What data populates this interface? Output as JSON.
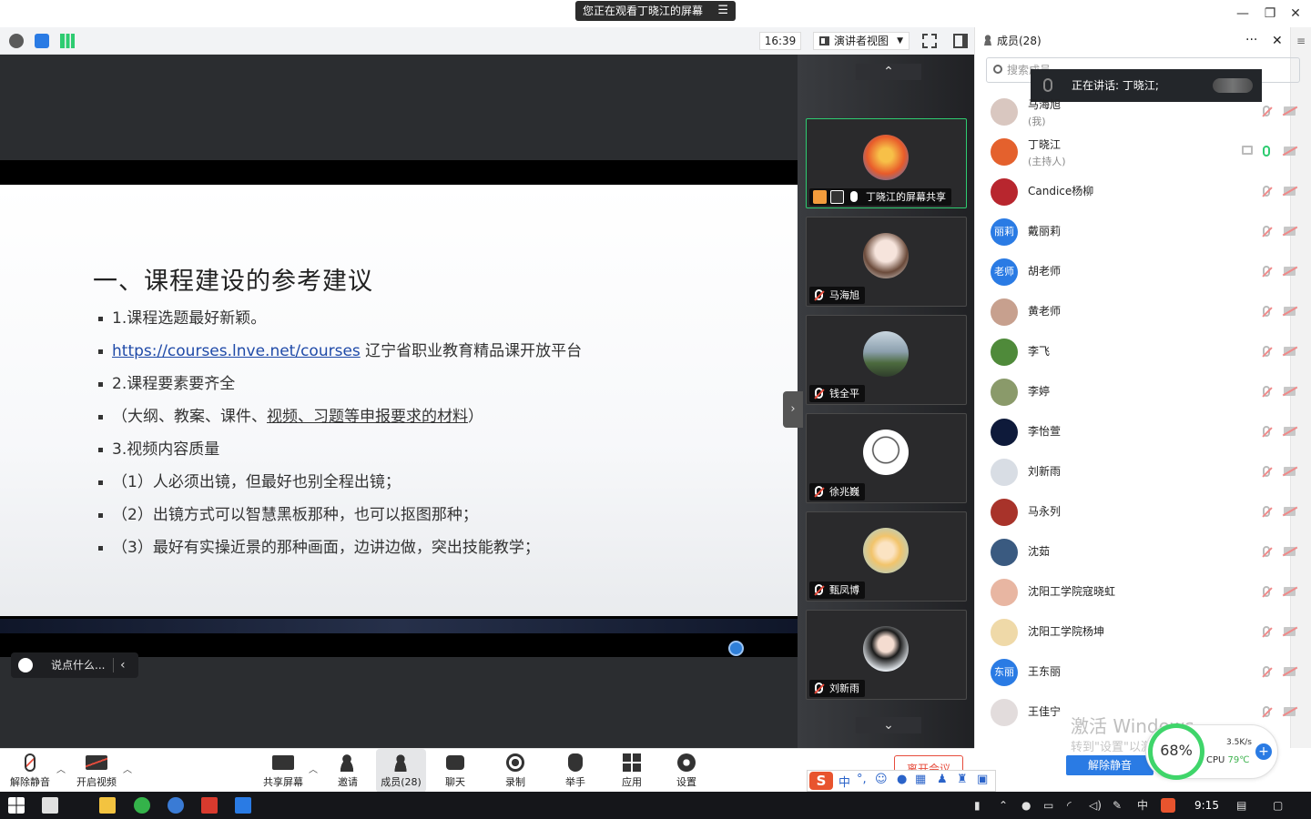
{
  "window": {
    "title": "您正在观看丁晓江的屏幕",
    "minimize": "—",
    "maximize": "❐",
    "close": "✕"
  },
  "toolbar": {
    "time": "16:39",
    "view_mode": "演讲者视图"
  },
  "slide": {
    "title": "一、课程建设的参考建议",
    "bullets": [
      {
        "pre": "1.课程选题最好新颖。",
        "link": "",
        "post": ""
      },
      {
        "pre": "",
        "link": "https://courses.lnve.net/courses",
        "post": " 辽宁省职业教育精品课开放平台"
      },
      {
        "pre": "2.课程要素要齐全",
        "link": "",
        "post": ""
      },
      {
        "pre": "（大纲、教案、课件、",
        "underline": "视频、习题等申报要求的材料",
        "post": "）"
      },
      {
        "pre": "3.视频内容质量",
        "link": "",
        "post": ""
      },
      {
        "pre": "（1）人必须出镜，但最好也别全程出镜；",
        "link": "",
        "post": ""
      },
      {
        "pre": "（2）出镜方式可以智慧黑板那种，也可以抠图那种；",
        "link": "",
        "post": ""
      },
      {
        "pre": "（3）最好有实操近景的那种画面，边讲边做，突出技能教学；",
        "link": "",
        "post": ""
      }
    ]
  },
  "chat": {
    "placeholder": "说点什么..."
  },
  "gallery": {
    "tiles": [
      {
        "name": "丁晓江的屏幕共享",
        "color": "#e85b2a"
      },
      {
        "name": "马海旭",
        "color": "#d8c7c2"
      },
      {
        "name": "钱全平",
        "color": "#7f9bb0"
      },
      {
        "name": "徐兆巍",
        "color": "#f0f0f0"
      },
      {
        "name": "甄凤博",
        "color": "#f2c46b"
      },
      {
        "name": "刘新雨",
        "color": "#dfe6ee"
      }
    ]
  },
  "panel": {
    "title": "成员(28)",
    "search_placeholder": "搜索成员",
    "speaking": "正在讲话: 丁晓江;",
    "members": [
      {
        "name": "马海旭",
        "role": "(我)",
        "avatar": "",
        "color": "#d9c7c0"
      },
      {
        "name": "丁晓江",
        "role": "(主持人)",
        "avatar": "",
        "color": "#e4612d"
      },
      {
        "name": "Candice杨柳",
        "role": "",
        "avatar": "",
        "color": "#b8262e"
      },
      {
        "name": "戴丽莉",
        "role": "",
        "avatar": "丽莉",
        "color": "#2a7be4"
      },
      {
        "name": "胡老师",
        "role": "",
        "avatar": "老师",
        "color": "#2a7be4"
      },
      {
        "name": "黄老师",
        "role": "",
        "avatar": "",
        "color": "#c7a08e"
      },
      {
        "name": "李飞",
        "role": "",
        "avatar": "",
        "color": "#4f8a3a"
      },
      {
        "name": "李婷",
        "role": "",
        "avatar": "",
        "color": "#8a9a6a"
      },
      {
        "name": "李怡萱",
        "role": "",
        "avatar": "",
        "color": "#0e1a3a"
      },
      {
        "name": "刘新雨",
        "role": "",
        "avatar": "",
        "color": "#d8dde4"
      },
      {
        "name": "马永列",
        "role": "",
        "avatar": "",
        "color": "#a8332a"
      },
      {
        "name": "沈茹",
        "role": "",
        "avatar": "",
        "color": "#3a5a80"
      },
      {
        "name": "沈阳工学院寇晓虹",
        "role": "",
        "avatar": "",
        "color": "#e8b6a2"
      },
      {
        "name": "沈阳工学院杨坤",
        "role": "",
        "avatar": "",
        "color": "#efd9a8"
      },
      {
        "name": "王东丽",
        "role": "",
        "avatar": "东丽",
        "color": "#2a7be4"
      },
      {
        "name": "王佳宁",
        "role": "",
        "avatar": "",
        "color": "#e2dcdc"
      }
    ],
    "watermark": "激活 Windows",
    "watermark_sub": "转到\"设置\"以激活Windows",
    "unmute_all": "解除静音"
  },
  "perf": {
    "percent": "68%",
    "net": "3.5K/s",
    "cpu_label": "CPU",
    "cpu_temp": "79℃"
  },
  "controls": {
    "unmute": "解除静音",
    "video": "开启视频",
    "share": "共享屏幕",
    "invite": "邀请",
    "members": "成员(28)",
    "chat": "聊天",
    "record": "录制",
    "raise": "举手",
    "apps": "应用",
    "settings": "设置",
    "leave": "离开会议"
  },
  "ime": {
    "lang": "中"
  },
  "taskbar": {
    "tray_lang": "中",
    "clock": "9:15"
  },
  "colors": {
    "accent": "#2a7be4",
    "danger": "#e74c3c",
    "active_green": "#2ecc71"
  }
}
